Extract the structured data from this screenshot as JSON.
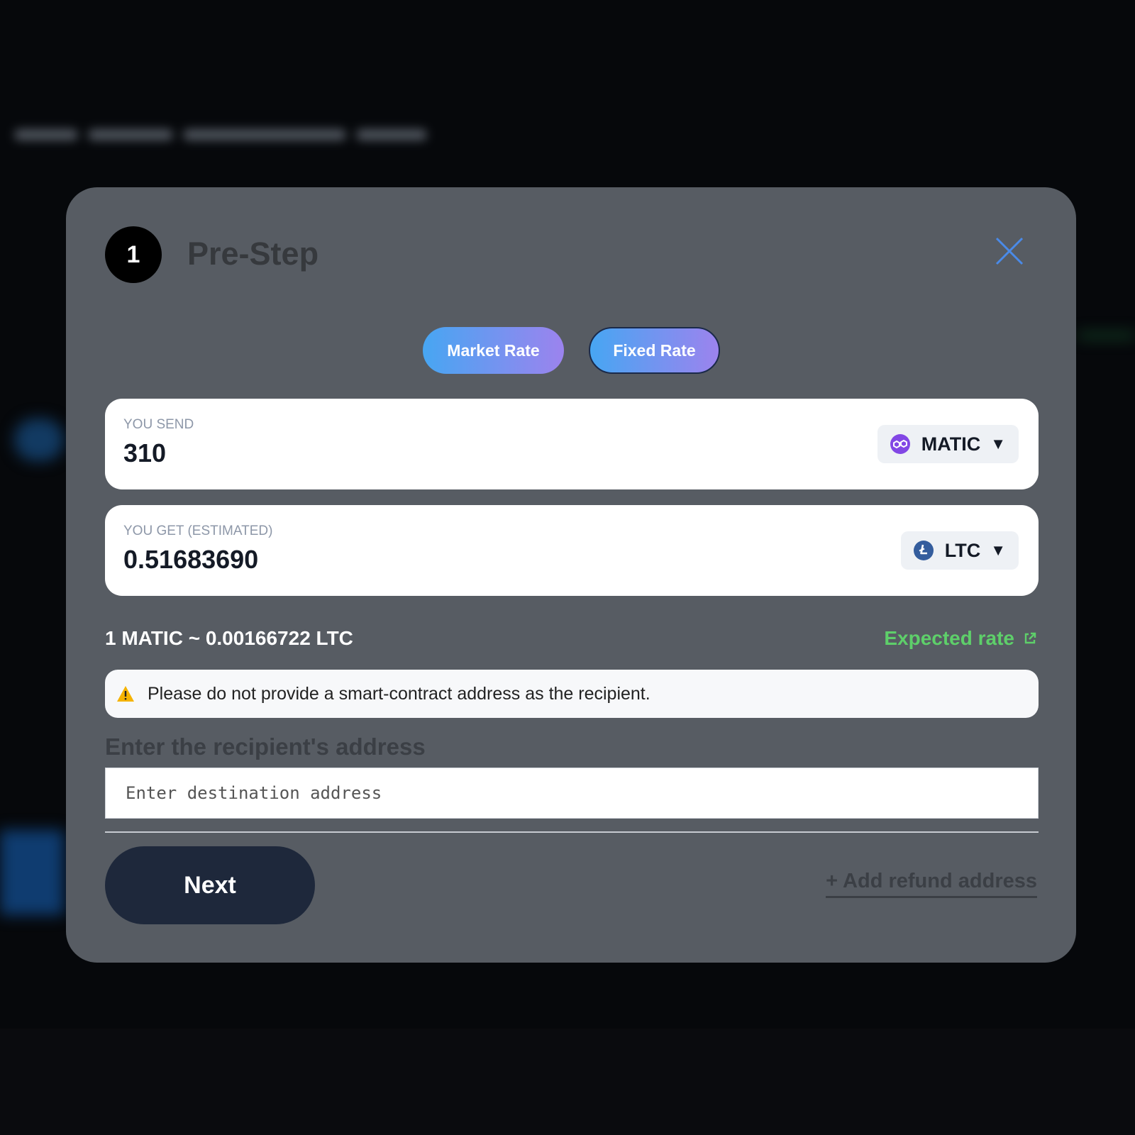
{
  "step": {
    "number": "1",
    "title": "Pre-Step"
  },
  "rate_modes": {
    "market": "Market Rate",
    "fixed": "Fixed Rate"
  },
  "send": {
    "label": "YOU SEND",
    "value": "310",
    "coin": "MATIC",
    "icon": "polygon-icon",
    "icon_color": "#8247e5"
  },
  "get": {
    "label": "YOU GET (ESTIMATED)",
    "value": "0.51683690",
    "coin": "LTC",
    "icon": "litecoin-icon",
    "icon_color": "#345d9d"
  },
  "rate": {
    "text": "1 MATIC ~ 0.00166722 LTC",
    "expected_label": "Expected rate",
    "expected_color": "#5ecf6a"
  },
  "warning": {
    "text": "Please do not provide a smart-contract address as the recipient.",
    "icon": "warning-icon",
    "icon_color": "#f5b301"
  },
  "recipient": {
    "heading": "Enter the recipient's address",
    "placeholder": "Enter destination address",
    "value": ""
  },
  "actions": {
    "next": "Next",
    "refund": "+ Add refund address"
  },
  "colors": {
    "modal_bg": "#575c63",
    "accent_gradient_start": "#47a6f2",
    "accent_gradient_end": "#9c83ee",
    "next_bg": "#1e283b"
  }
}
